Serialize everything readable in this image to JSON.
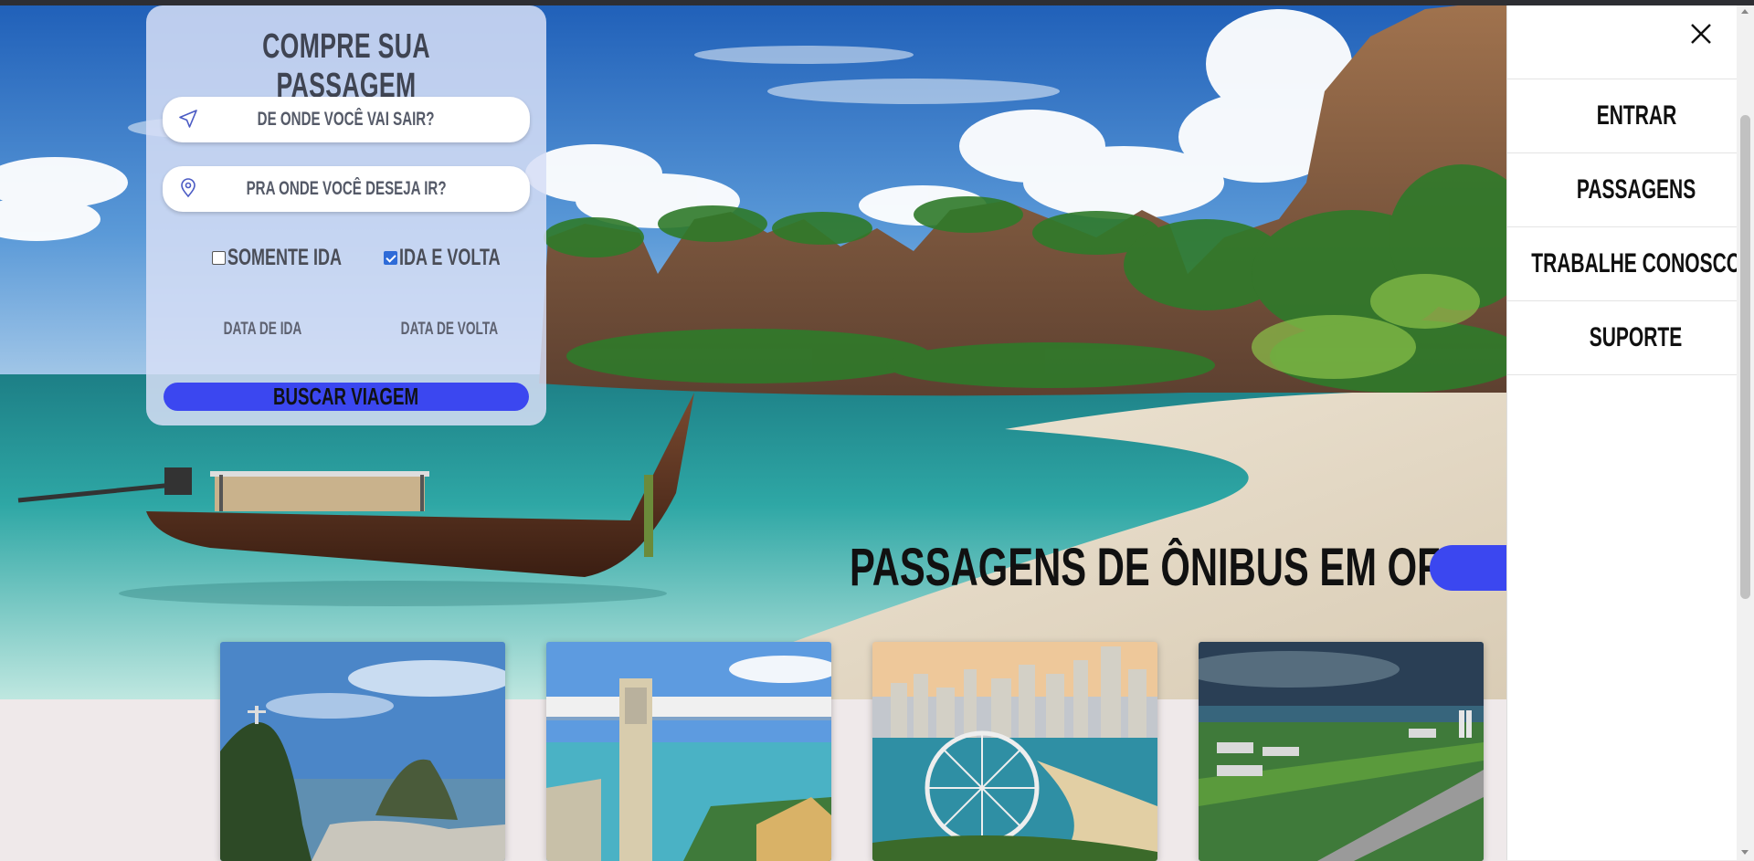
{
  "booking": {
    "title": "COMPRE SUA PASSAGEM",
    "origin_placeholder": "DE ONDE VOCÊ VAI SAIR?",
    "destination_placeholder": "PRA ONDE VOCÊ DESEJA IR?",
    "one_way_label": "SOMENTE IDA",
    "one_way_checked": false,
    "round_trip_label": "IDA E VOLTA",
    "round_trip_checked": true,
    "departure_date_label": "DATA DE IDA",
    "return_date_label": "DATA DE VOLTA",
    "search_button": "BUSCAR VIAGEM"
  },
  "offers": {
    "title": "PASSAGENS DE ÔNIBUS EM OFERTA",
    "cards": [
      "rio-de-janeiro-photo",
      "salvador-photo",
      "balneario-camboriu-photo",
      "brasilia-photo"
    ]
  },
  "menu": {
    "close_icon": "close-icon",
    "items": [
      "ENTRAR",
      "PASSAGENS",
      "TRABALHE CONOSCO",
      "SUPORTE"
    ]
  },
  "colors": {
    "accent": "#3b47f0",
    "panel": "#d6def6",
    "background": "#efe9ea"
  }
}
